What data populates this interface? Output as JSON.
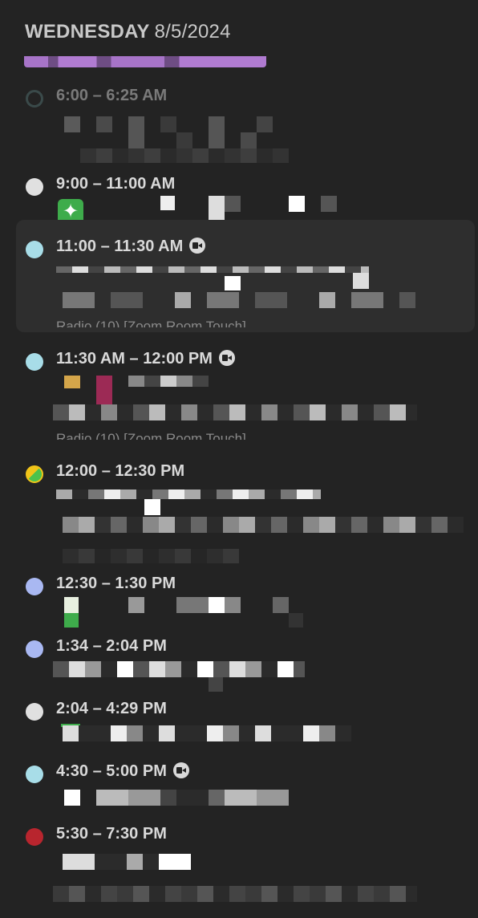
{
  "header": {
    "day": "WEDNESDAY",
    "date": "8/5/2024"
  },
  "events": [
    {
      "time": "6:00 – 6:25 AM",
      "dot_color": "#3a4a4a",
      "past": true,
      "video": false
    },
    {
      "time": "9:00 – 11:00 AM",
      "dot_color": "#e0e0e0",
      "past": false,
      "video": false,
      "icon": "sparkle-icon"
    },
    {
      "time": "11:00 – 11:30 AM",
      "dot_color": "#a8dde8",
      "past": false,
      "video": true,
      "selected": true,
      "room": "Radio (10) [Zoom Room Touch]"
    },
    {
      "time": "11:30 AM – 12:00 PM",
      "dot_color": "#a8dde8",
      "past": false,
      "video": true,
      "room": "Radio (10) [Zoom Room Touch]"
    },
    {
      "time": "12:00 – 12:30 PM",
      "dot_color": "#f0c419",
      "dot_color2": "#4cc24c",
      "past": false,
      "video": false
    },
    {
      "time": "12:30 – 1:30 PM",
      "dot_color": "#a9b8f2",
      "past": false,
      "video": false
    },
    {
      "time": "1:34 – 2:04 PM",
      "dot_color": "#a9b8f2",
      "past": false,
      "video": false
    },
    {
      "time": "2:04 – 4:29 PM",
      "dot_color": "#e0e0e0",
      "past": false,
      "video": false
    },
    {
      "time": "4:30 – 5:00 PM",
      "dot_color": "#a8dde8",
      "past": false,
      "video": true
    },
    {
      "time": "5:30 – 7:30 PM",
      "dot_color": "#b8252e",
      "past": false,
      "video": false
    }
  ],
  "colors": {
    "background": "#232323",
    "selected_bg": "#2e2e2e",
    "text": "#d9d9d9"
  }
}
